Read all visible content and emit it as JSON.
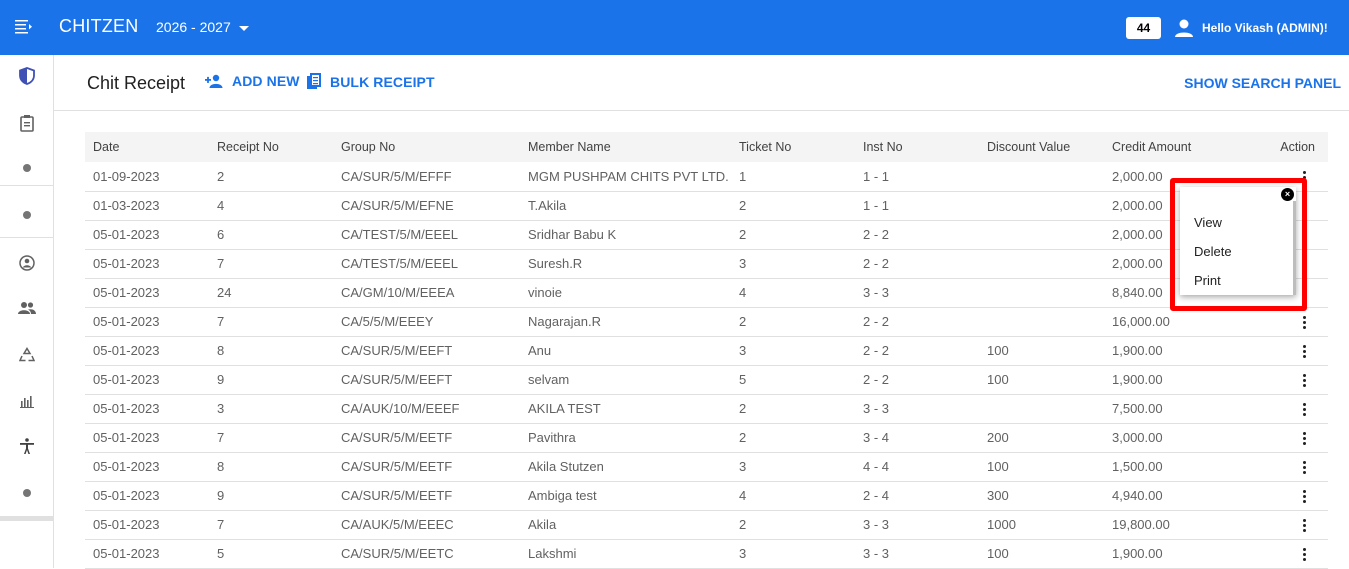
{
  "header": {
    "app_title": "CHITZEN",
    "year": "2026 - 2027",
    "badge_count": "44",
    "greeting": "Hello Vikash (ADMIN)!"
  },
  "sidebar": {
    "icons": [
      "shield-icon",
      "clipboard-icon",
      "dot-icon",
      "dot-icon",
      "account-circle-icon",
      "people-icon",
      "recycle-icon",
      "bar-chart-icon",
      "accessibility-icon",
      "dot-icon"
    ]
  },
  "page": {
    "title": "Chit Receipt",
    "add_new": "ADD NEW",
    "bulk_receipt": "BULK RECEIPT",
    "search_panel": "SHOW SEARCH PANEL"
  },
  "table": {
    "columns": [
      "Date",
      "Receipt No",
      "Group No",
      "Member Name",
      "Ticket No",
      "Inst No",
      "Discount Value",
      "Credit Amount",
      "Action"
    ],
    "rows": [
      [
        "01-09-2023",
        "2",
        "CA/SUR/5/M/EFFF",
        "MGM PUSHPAM CHITS PVT LTD.",
        "1",
        "1 - 1",
        "",
        "2,000.00"
      ],
      [
        "01-03-2023",
        "4",
        "CA/SUR/5/M/EFNE",
        "T.Akila",
        "2",
        "1 - 1",
        "",
        "2,000.00"
      ],
      [
        "05-01-2023",
        "6",
        "CA/TEST/5/M/EEEL",
        "Sridhar Babu K",
        "2",
        "2 - 2",
        "",
        "2,000.00"
      ],
      [
        "05-01-2023",
        "7",
        "CA/TEST/5/M/EEEL",
        "Suresh.R",
        "3",
        "2 - 2",
        "",
        "2,000.00"
      ],
      [
        "05-01-2023",
        "24",
        "CA/GM/10/M/EEEA",
        "vinoie",
        "4",
        "3 - 3",
        "",
        "8,840.00"
      ],
      [
        "05-01-2023",
        "7",
        "CA/5/5/M/EEEY",
        "Nagarajan.R",
        "2",
        "2 - 2",
        "",
        "16,000.00"
      ],
      [
        "05-01-2023",
        "8",
        "CA/SUR/5/M/EEFT",
        "Anu",
        "3",
        "2 - 2",
        "100",
        "1,900.00"
      ],
      [
        "05-01-2023",
        "9",
        "CA/SUR/5/M/EEFT",
        "selvam",
        "5",
        "2 - 2",
        "100",
        "1,900.00"
      ],
      [
        "05-01-2023",
        "3",
        "CA/AUK/10/M/EEEF",
        "AKILA TEST",
        "2",
        "3 - 3",
        "",
        "7,500.00"
      ],
      [
        "05-01-2023",
        "7",
        "CA/SUR/5/M/EETF",
        "Pavithra",
        "2",
        "3 - 4",
        "200",
        "3,000.00"
      ],
      [
        "05-01-2023",
        "8",
        "CA/SUR/5/M/EETF",
        "Akila Stutzen",
        "3",
        "4 - 4",
        "100",
        "1,500.00"
      ],
      [
        "05-01-2023",
        "9",
        "CA/SUR/5/M/EETF",
        "Ambiga test",
        "4",
        "2 - 4",
        "300",
        "4,940.00"
      ],
      [
        "05-01-2023",
        "7",
        "CA/AUK/5/M/EEEC",
        "Akila",
        "2",
        "3 - 3",
        "1000",
        "19,800.00"
      ],
      [
        "05-01-2023",
        "5",
        "CA/SUR/5/M/EETC",
        "Lakshmi",
        "3",
        "3 - 3",
        "100",
        "1,900.00"
      ]
    ],
    "hidden_action_rows": [
      1,
      2,
      3,
      4
    ]
  },
  "action_menu": {
    "close": "×",
    "items": [
      "View",
      "Delete",
      "Print"
    ]
  },
  "colors": {
    "primary": "#1a73e8",
    "highlight": "#ff0000"
  }
}
